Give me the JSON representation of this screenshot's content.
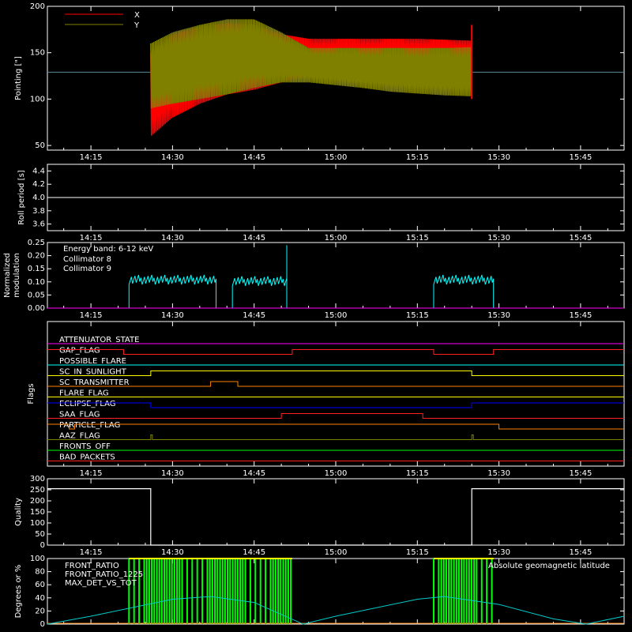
{
  "time_ticks": [
    "14:15",
    "14:30",
    "14:45",
    "15:00",
    "15:15",
    "15:30",
    "15:45"
  ],
  "chart_data": [
    {
      "type": "line",
      "panel": "pointing",
      "ylabel": "Pointing [\"]",
      "ylim": [
        45,
        200
      ],
      "yticks": [
        50,
        100,
        150,
        200
      ],
      "xlim": [
        "14:07",
        "15:53"
      ],
      "reference_line": 129,
      "legend": [
        {
          "name": "X",
          "color": "#ff0000"
        },
        {
          "name": "Y",
          "color": "#808000"
        }
      ],
      "series": [
        {
          "name": "X",
          "color": "#ff0000",
          "x": [
            "14:26",
            "14:30",
            "14:35",
            "14:40",
            "14:45",
            "14:50",
            "14:55",
            "15:00",
            "15:05",
            "15:10",
            "15:15",
            "15:20",
            "15:25"
          ],
          "upper": [
            150,
            170,
            178,
            182,
            180,
            170,
            165,
            165,
            165,
            165,
            165,
            164,
            163
          ],
          "lower": [
            60,
            80,
            95,
            105,
            110,
            118,
            125,
            128,
            128,
            128,
            128,
            128,
            128
          ]
        },
        {
          "name": "Y",
          "color": "#808000",
          "x": [
            "14:26",
            "14:30",
            "14:35",
            "14:40",
            "14:45",
            "14:50",
            "14:55",
            "15:00",
            "15:05",
            "15:10",
            "15:15",
            "15:20",
            "15:25"
          ],
          "upper": [
            160,
            172,
            180,
            186,
            186,
            172,
            155,
            155,
            155,
            155,
            155,
            155,
            156
          ],
          "lower": [
            90,
            95,
            100,
            105,
            112,
            118,
            118,
            115,
            112,
            108,
            106,
            104,
            103
          ]
        }
      ]
    },
    {
      "type": "line",
      "panel": "roll",
      "ylabel": "Roll period [s]",
      "ylim": [
        3.5,
        4.5
      ],
      "yticks": [
        "3.6",
        "3.8",
        "4.0",
        "4.2",
        "4.4"
      ],
      "series": [
        {
          "name": "",
          "color": "#ffffff",
          "x": [
            "14:07",
            "15:53"
          ],
          "y": [
            4.0,
            4.0
          ]
        }
      ]
    },
    {
      "type": "line",
      "panel": "modulation",
      "ylabel": "Normalized modulation",
      "ylim": [
        0,
        0.25
      ],
      "yticks": [
        "0.00",
        "0.05",
        "0.10",
        "0.15",
        "0.20",
        "0.25"
      ],
      "annotation": "Energy band: 6-12 keV",
      "series": [
        {
          "name": "Collimator 8",
          "color": "#00ffff",
          "segments": [
            [
              "14:22",
              "14:38",
              0.11
            ],
            [
              "14:41",
              "14:51",
              0.105
            ],
            [
              "15:18",
              "15:29",
              0.11
            ]
          ]
        },
        {
          "name": "Collimator 9",
          "color": "#ff00ff",
          "segments": [
            [
              "14:07",
              "15:53",
              0.0
            ]
          ]
        }
      ]
    },
    {
      "type": "line",
      "panel": "flags",
      "ylabel": "Flags",
      "series": [
        {
          "name": "ATTENUATOR_STATE",
          "color": "#ff00ff",
          "transitions": []
        },
        {
          "name": "GAP_FLAG",
          "color": "#ff2020",
          "transitions": [
            "14:21",
            "14:52",
            "15:18",
            "15:29"
          ],
          "initial_high": true
        },
        {
          "name": "POSSIBLE_FLARE",
          "color": "#00ffff",
          "transitions": []
        },
        {
          "name": "SC_IN_SUNLIGHT",
          "color": "#ffff00",
          "transitions": [
            "14:26",
            "15:25"
          ],
          "initial_high": false
        },
        {
          "name": "SC_TRANSMITTER",
          "color": "#ff8000",
          "transitions": [
            "14:37",
            "14:42"
          ],
          "initial_high": false
        },
        {
          "name": "FLARE_FLAG",
          "color": "#ffff00",
          "transitions": []
        },
        {
          "name": "ECLIPSE_FLAG",
          "color": "#0000ff",
          "transitions": [
            "14:26",
            "15:25"
          ],
          "initial_high": true
        },
        {
          "name": "SAA_FLAG",
          "color": "#ff2020",
          "transitions": [
            "14:50",
            "15:16"
          ],
          "initial_high": false
        },
        {
          "name": "PARTICLE_FLAG",
          "color": "#ff8000",
          "transitions": [
            "14:11",
            "14:12",
            "15:30"
          ],
          "initial_high": true
        },
        {
          "name": "AAZ_FLAG",
          "color": "#808000",
          "transitions": [
            "14:26",
            "15:25"
          ],
          "spikes": true
        },
        {
          "name": "FRONTS_OFF",
          "color": "#00ff00",
          "transitions": []
        },
        {
          "name": "BAD_PACKETS",
          "color": "#ff2020",
          "transitions": []
        }
      ]
    },
    {
      "type": "line",
      "panel": "quality",
      "ylabel": "Quality",
      "ylim": [
        0,
        300
      ],
      "yticks": [
        "0",
        "50",
        "100",
        "150",
        "200",
        "250",
        "300"
      ],
      "series": [
        {
          "name": "",
          "color": "#ffffff",
          "x": [
            "14:07",
            "14:26",
            "14:26",
            "15:25",
            "15:25",
            "15:53"
          ],
          "y": [
            255,
            255,
            0,
            0,
            255,
            255
          ]
        }
      ]
    },
    {
      "type": "area",
      "panel": "ratios",
      "ylabel": "Degrees or %",
      "ylim": [
        0,
        100
      ],
      "yticks": [
        "0",
        "20",
        "40",
        "60",
        "80",
        "100"
      ],
      "annotation": "Absolute geomagnetic latitude",
      "series": [
        {
          "name": "FRONT_RATIO",
          "color": "#ffff00",
          "x": [
            "14:22",
            "14:52",
            "15:18",
            "15:29"
          ]
        },
        {
          "name": "FRONT_RATIO_1225",
          "color": "#00ff00",
          "x": [
            "14:22",
            "14:52",
            "15:18",
            "15:29"
          ]
        },
        {
          "name": "MAX_DET_VS_TOT",
          "color": "#ff8000",
          "x": []
        },
        {
          "name": "Absolute geomagnetic latitude",
          "color": "#00cccc",
          "x": [
            "14:07",
            "14:15",
            "14:30",
            "14:37",
            "14:45",
            "14:54",
            "15:00",
            "15:15",
            "15:20",
            "15:30",
            "15:40",
            "15:46",
            "15:53"
          ],
          "y": [
            0,
            12,
            38,
            42,
            33,
            0,
            12,
            38,
            42,
            30,
            8,
            0,
            12
          ]
        }
      ]
    }
  ]
}
